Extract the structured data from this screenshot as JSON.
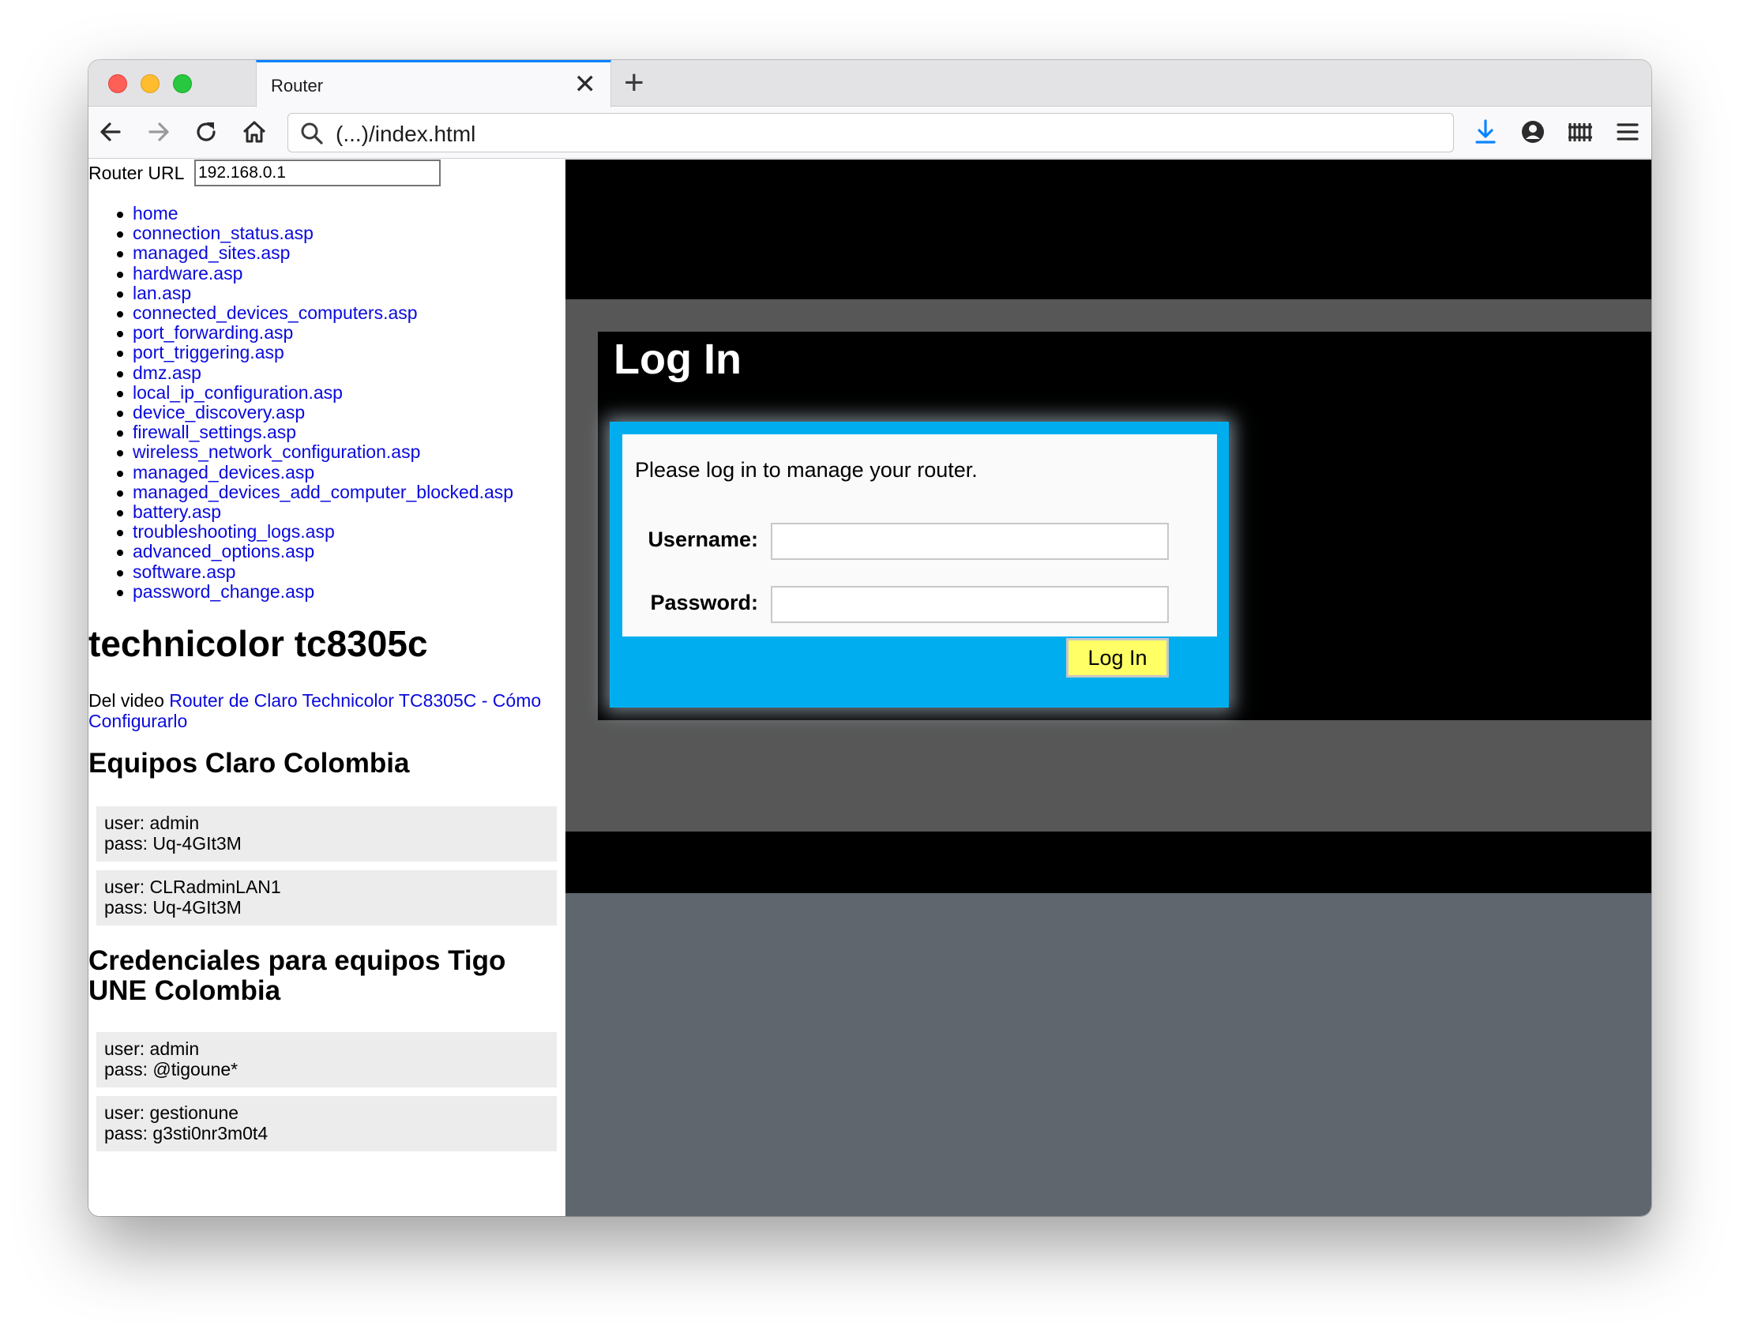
{
  "browser": {
    "tab_title": "Router",
    "tab_close": "✕",
    "new_tab": "+",
    "url": "(...)/index.html",
    "accent_color": "#0a84ff"
  },
  "sidebar": {
    "router_url_label": "Router URL",
    "router_url_value": "192.168.0.1",
    "links": [
      "home",
      "connection_status.asp",
      "managed_sites.asp",
      "hardware.asp",
      "lan.asp",
      "connected_devices_computers.asp",
      "port_forwarding.asp",
      "port_triggering.asp",
      "dmz.asp",
      "local_ip_configuration.asp",
      "device_discovery.asp",
      "firewall_settings.asp",
      "wireless_network_configuration.asp",
      "managed_devices.asp",
      "managed_devices_add_computer_blocked.asp",
      "battery.asp",
      "troubleshooting_logs.asp",
      "advanced_options.asp",
      "software.asp",
      "password_change.asp"
    ],
    "title": "technicolor tc8305c",
    "video_prefix": "Del video ",
    "video_link": "Router de Claro Technicolor TC8305C - Cómo Configurarlo",
    "claro_heading": "Equipos Claro Colombia",
    "claro_creds": [
      {
        "user": "user: admin",
        "pass": "pass: Uq-4GIt3M"
      },
      {
        "user": "user: CLRadminLAN1",
        "pass": "pass: Uq-4GIt3M"
      }
    ],
    "tigo_heading": "Credenciales para equipos Tigo UNE Colombia",
    "tigo_creds": [
      {
        "user": "user: admin",
        "pass": "pass: @tigoune*"
      },
      {
        "user": "user: gestionune",
        "pass": "pass: g3sti0nr3m0t4"
      }
    ]
  },
  "login": {
    "title": "Log In",
    "message": "Please log in to manage your router.",
    "username_label": "Username:",
    "password_label": "Password:",
    "username_value": "",
    "password_value": "",
    "button_label": "Log In",
    "box_color": "#00aeef",
    "button_color": "#ffff66"
  }
}
